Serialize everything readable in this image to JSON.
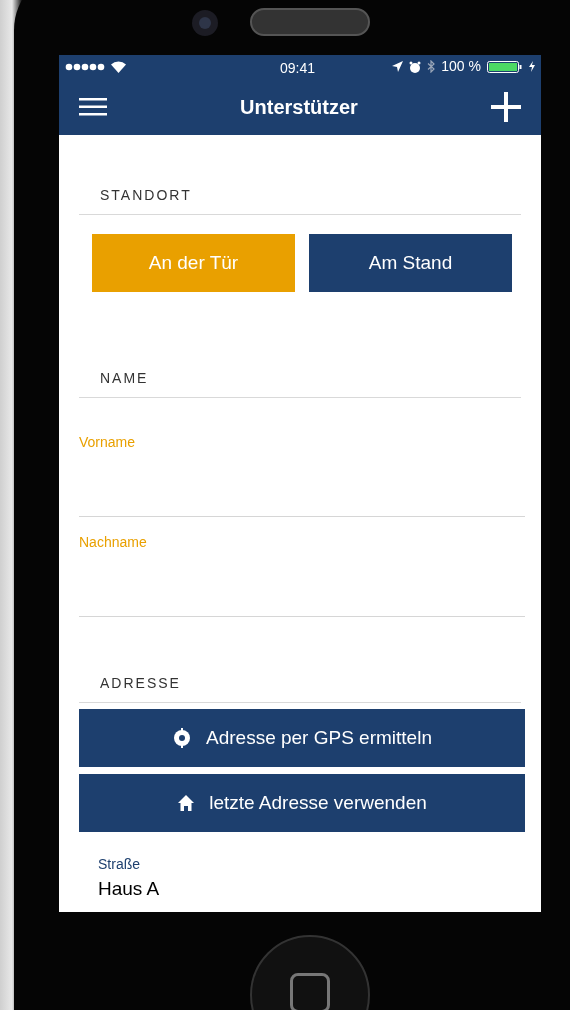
{
  "status_bar": {
    "time": "09:41",
    "battery": "100 %"
  },
  "nav_bar": {
    "title": "Unterstützer"
  },
  "sections": [
    {
      "kind": "choice",
      "title": "STANDORT",
      "options": [
        {
          "label": "An der Tür",
          "selected": true
        },
        {
          "label": "Am Stand",
          "selected": false
        }
      ]
    },
    {
      "kind": "fields",
      "title": "NAME",
      "fields": [
        {
          "label": "Vorname"
        },
        {
          "label": "Nachname"
        }
      ]
    },
    {
      "kind": "address",
      "title": "ADRESSE",
      "buttons": [
        {
          "label": "Adresse per GPS ermitteln",
          "kind": "gps"
        },
        {
          "label": "letzte Adresse verwenden",
          "kind": "home"
        }
      ],
      "fields": [
        {
          "label": "Straße",
          "value": "Haus A"
        }
      ]
    }
  ]
}
